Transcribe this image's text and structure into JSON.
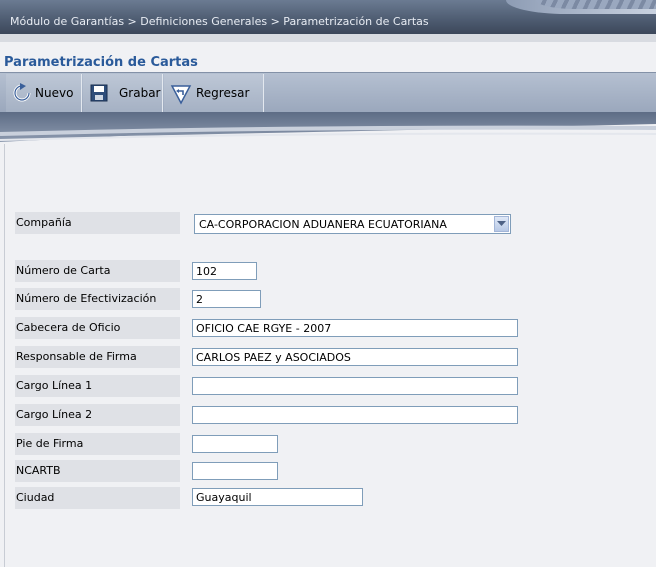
{
  "breadcrumb": "Módulo de Garantías > Definiciones Generales > Parametrización de Cartas",
  "page_title": "Parametrización de Cartas",
  "toolbar": {
    "nuevo_label": "Nuevo",
    "grabar_label": "Grabar",
    "regresar_label": "Regresar"
  },
  "form": {
    "compania_label": "Compañía",
    "compania_value": "CA-CORPORACION ADUANERA ECUATORIANA",
    "numero_carta_label": "Número de Carta",
    "numero_carta_value": "102",
    "numero_efectivizacion_label": "Número de Efectivización",
    "numero_efectivizacion_value": "2",
    "cabecera_label": "Cabecera de Oficio",
    "cabecera_value": "OFICIO CAE RGYE - 2007",
    "responsable_label": "Responsable de Firma",
    "responsable_value": "CARLOS PAEZ y ASOCIADOS",
    "cargo1_label": "Cargo Línea 1",
    "cargo1_value": "",
    "cargo2_label": "Cargo Línea 2",
    "cargo2_value": "",
    "pie_label": "Pie de Firma",
    "pie_value": "",
    "ncartb_label": "NCARTB",
    "ncartb_value": "",
    "ciudad_label": "Ciudad",
    "ciudad_value": "Guayaquil"
  },
  "colors": {
    "title": "#2a5a9a",
    "header": "#4d5b70",
    "toolbar": "#a5b1c4",
    "background": "#f0f1f4"
  }
}
